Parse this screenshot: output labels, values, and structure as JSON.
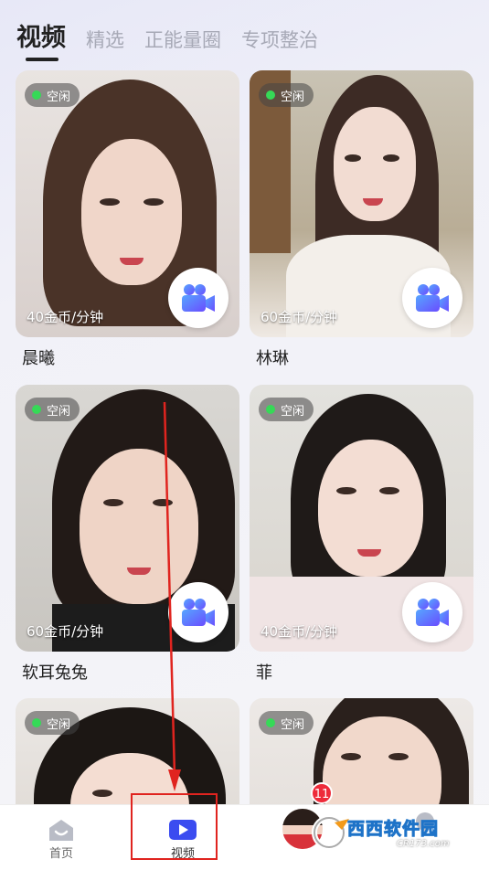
{
  "tabs": [
    "视频",
    "精选",
    "正能量圈",
    "专项整治"
  ],
  "cards": [
    {
      "status": "空闲",
      "price": "40金币/分钟",
      "name": "晨曦"
    },
    {
      "status": "空闲",
      "price": "60金币/分钟",
      "name": "林琳"
    },
    {
      "status": "空闲",
      "price": "60金币/分钟",
      "name": "软耳兔兔"
    },
    {
      "status": "空闲",
      "price": "40金币/分钟",
      "name": "菲"
    },
    {
      "status": "空闲"
    },
    {
      "status": "空闲"
    }
  ],
  "bottom_nav": {
    "home_label": "首页",
    "video_label": "视频",
    "message_badge": "11"
  },
  "watermark": {
    "text": "西西软件园",
    "sub": "CR173.com"
  },
  "colors": {
    "accent": "#3b4cf0",
    "online": "#36d957",
    "annotation": "#e0241f",
    "badge": "#ee2b3a"
  }
}
